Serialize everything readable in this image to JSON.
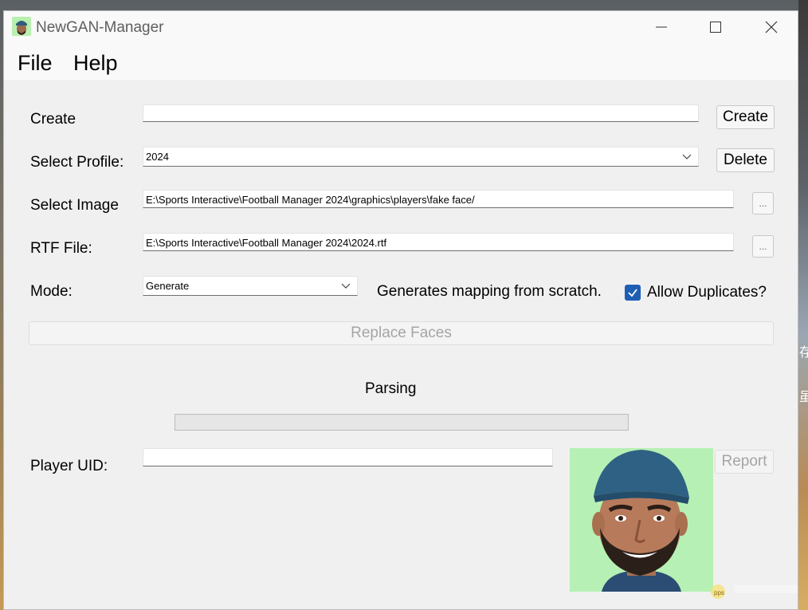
{
  "window": {
    "title": "NewGAN-Manager"
  },
  "menu": {
    "file": "File",
    "help": "Help"
  },
  "create": {
    "label": "Create",
    "input_value": "",
    "button": "Create"
  },
  "profile": {
    "label": "Select Profile:",
    "selected": "2024",
    "delete_button": "Delete"
  },
  "image": {
    "label": "Select Image",
    "path": "E:\\Sports Interactive\\Football Manager 2024\\graphics\\players\\fake face/",
    "browse": "..."
  },
  "rtf": {
    "label": "RTF File:",
    "path": "E:\\Sports Interactive\\Football Manager 2024\\2024.rtf",
    "browse": "..."
  },
  "mode": {
    "label": "Mode:",
    "selected": "Generate",
    "description": "Generates mapping from scratch.",
    "allow_duplicates_label": "Allow Duplicates?",
    "allow_duplicates_checked": true
  },
  "replace_button": "Replace Faces",
  "status": {
    "text": "Parsing",
    "progress": 0
  },
  "player": {
    "label": "Player UID:",
    "value": "",
    "report_button": "Report"
  },
  "colors": {
    "accent": "#1e5fb4",
    "photo_bg": "#b6f0b4",
    "window_bg": "#f0f0f0"
  }
}
